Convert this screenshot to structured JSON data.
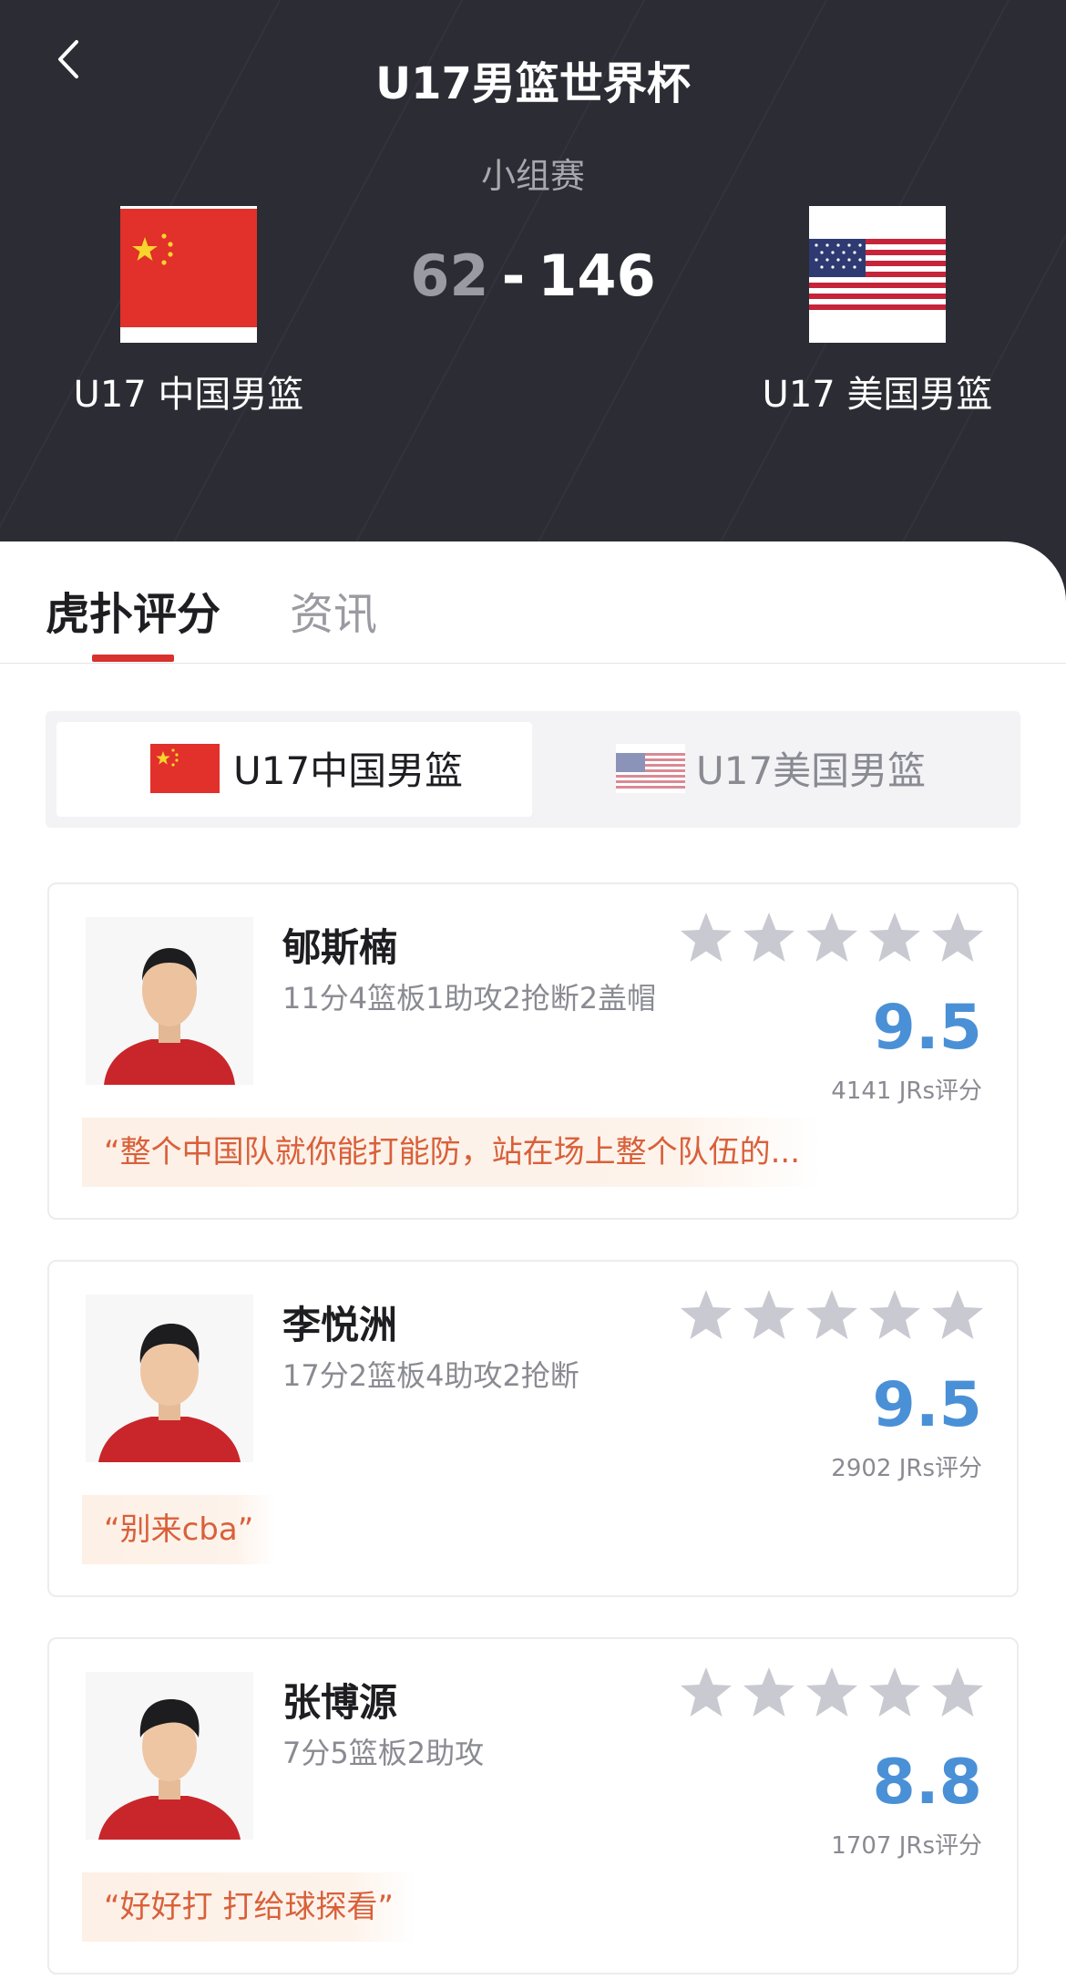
{
  "header": {
    "title": "U17男篮世界杯",
    "stage": "小组赛",
    "score_home": "62",
    "score_sep": "-",
    "score_away": "146",
    "home_team": "U17 中国男篮",
    "away_team": "U17 美国男篮",
    "back_icon": "chevron-left-icon"
  },
  "tabs": [
    {
      "label": "虎扑评分"
    },
    {
      "label": "资讯"
    }
  ],
  "team_switch": [
    {
      "label": "U17中国男篮",
      "flag": "china-flag-icon"
    },
    {
      "label": "U17美国男篮",
      "flag": "usa-flag-icon"
    }
  ],
  "players": [
    {
      "name": "郇斯楠",
      "stats": "11分4篮板1助攻2抢断2盖帽",
      "stars": 5,
      "rating": "9.5",
      "votes": "4141 JRs评分",
      "quote": "“整个中国队就你能打能防，站在场上整个队伍的..."
    },
    {
      "name": "李悦洲",
      "stats": "17分2篮板4助攻2抢断",
      "stars": 5,
      "rating": "9.5",
      "votes": "2902 JRs评分",
      "quote": "“别来cba”"
    },
    {
      "name": "张博源",
      "stats": "7分5篮板2助攻",
      "stars": 5,
      "rating": "8.8",
      "votes": "1707 JRs评分",
      "quote": "“好好打 打给球探看”"
    }
  ],
  "colors": {
    "header_bg": "#2c2c34",
    "accent_red": "#d8312e",
    "rating_blue": "#4a90d6",
    "quote_orange": "#d9603a",
    "star_gray": "#c9c9d1"
  }
}
